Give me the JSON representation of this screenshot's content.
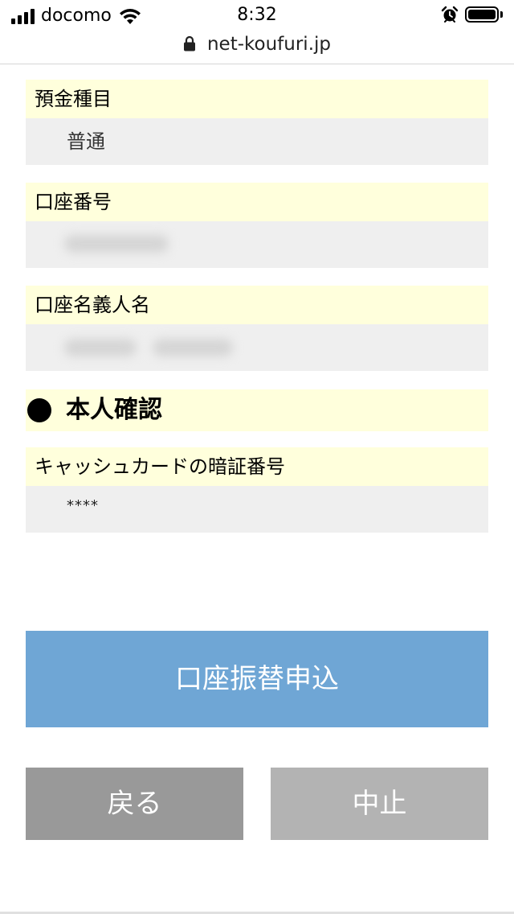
{
  "status_bar": {
    "carrier": "docomo",
    "time": "8:32",
    "icons": [
      "signal-icon",
      "wifi-icon",
      "alarm-icon",
      "battery-icon"
    ]
  },
  "browser": {
    "url": "net-koufuri.jp",
    "icon": "lock-icon"
  },
  "fields": {
    "deposit_type": {
      "label": "預金種目",
      "value": "普通"
    },
    "account_number": {
      "label": "口座番号",
      "value": ""
    },
    "account_holder": {
      "label": "口座名義人名",
      "value": ""
    }
  },
  "identity": {
    "section_title": "本人確認",
    "pin_label": "キャッシュカードの暗証番号",
    "pin_value": "****"
  },
  "buttons": {
    "apply": "口座振替申込",
    "back": "戻る",
    "cancel": "中止"
  },
  "colors": {
    "label_bg": "#ffffdc",
    "value_bg": "#efefef",
    "primary": "#6fa6d5",
    "back": "#999999",
    "cancel": "#b3b3b3"
  }
}
